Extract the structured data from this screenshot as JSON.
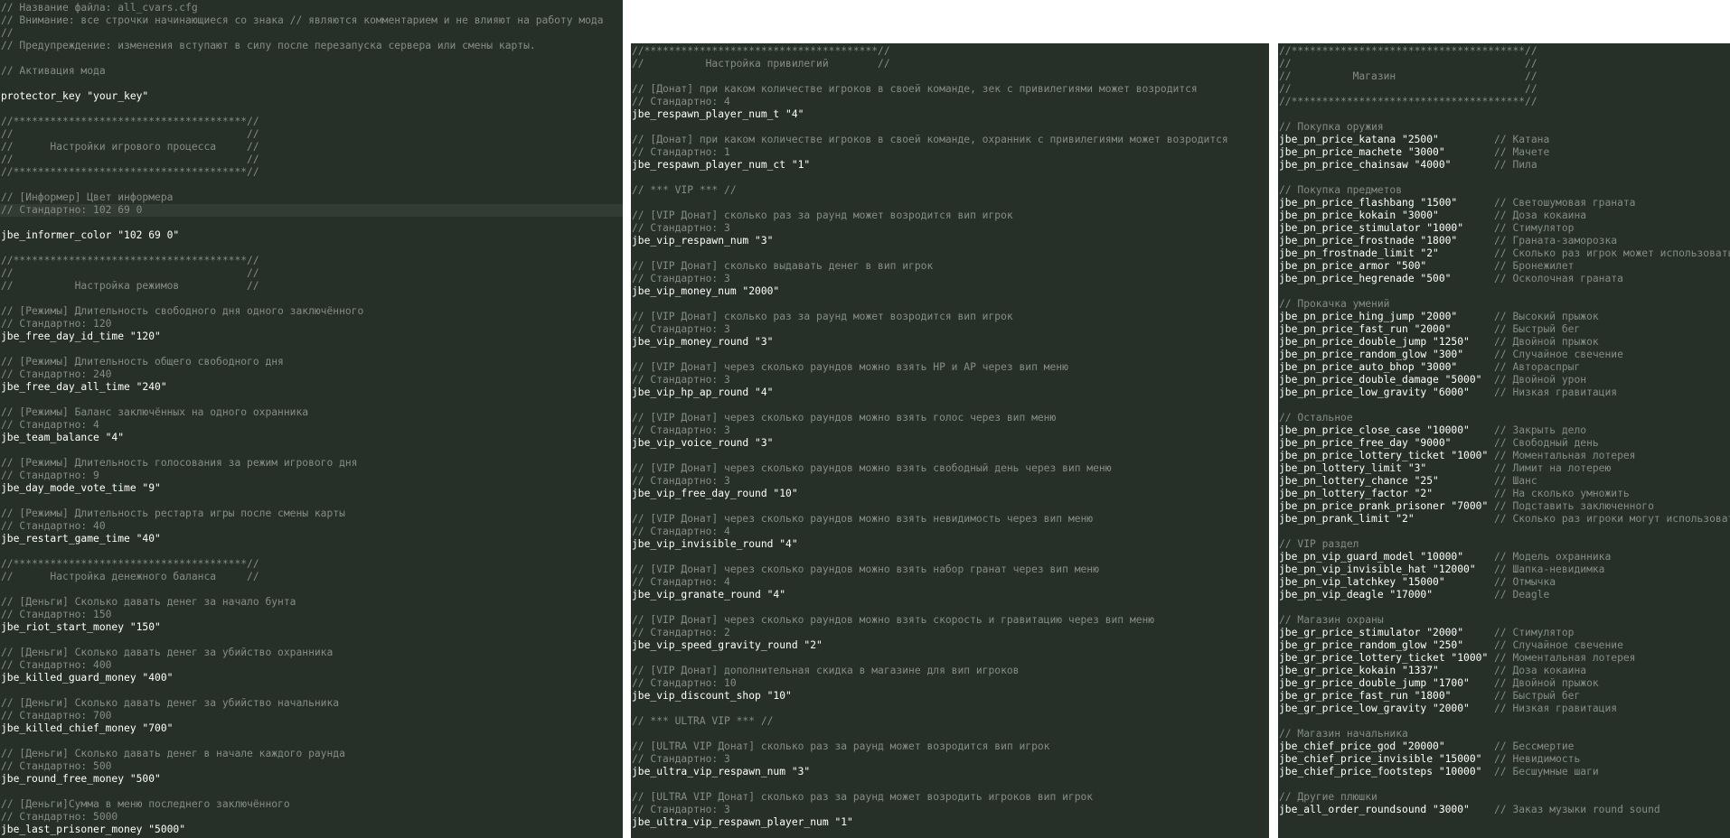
{
  "panels": [
    {
      "lines": [
        {
          "c": "// Название файла: all_cvars.cfg"
        },
        {
          "c": "// Внимание: все строчки начинающиеся со знака // являются комментарием и не влияют на работу мода"
        },
        {
          "c": "//"
        },
        {
          "c": "// Предупреждение: изменения вступают в силу после перезапуска сервера или смены карты."
        },
        {
          "b": true
        },
        {
          "c": "// Активация мода"
        },
        {
          "b": true
        },
        {
          "k": "protector_key \"your_key\""
        },
        {
          "b": true
        },
        {
          "c": "//**************************************//"
        },
        {
          "c": "//                                      //"
        },
        {
          "c": "//      Настройки игрового процесса     //"
        },
        {
          "c": "//                                      //"
        },
        {
          "c": "//**************************************//"
        },
        {
          "b": true
        },
        {
          "c": "// [Информер] Цвет информера"
        },
        {
          "c": "// Стандартно: 102 69 0",
          "hl": true
        },
        {
          "b": true
        },
        {
          "k": "jbe_informer_color \"102 69 0\""
        },
        {
          "b": true
        },
        {
          "c": "//**************************************//"
        },
        {
          "c": "//                                      //"
        },
        {
          "c": "//          Настройка режимов           //"
        },
        {
          "b": true
        },
        {
          "c": "// [Режимы] Длительность свободного дня одного заключённого"
        },
        {
          "c": "// Стандартно: 120"
        },
        {
          "k": "jbe_free_day_id_time \"120\""
        },
        {
          "b": true
        },
        {
          "c": "// [Режимы] Длительность общего свободного дня"
        },
        {
          "c": "// Стандартно: 240"
        },
        {
          "k": "jbe_free_day_all_time \"240\""
        },
        {
          "b": true
        },
        {
          "c": "// [Режимы] Баланс заключённых на одного охранника"
        },
        {
          "c": "// Стандартно: 4"
        },
        {
          "k": "jbe_team_balance \"4\""
        },
        {
          "b": true
        },
        {
          "c": "// [Режимы] Длительность голосования за режим игрового дня"
        },
        {
          "c": "// Стандартно: 9"
        },
        {
          "k": "jbe_day_mode_vote_time \"9\""
        },
        {
          "b": true
        },
        {
          "c": "// [Режимы] Длительность рестарта игры после смены карты"
        },
        {
          "c": "// Стандартно: 40"
        },
        {
          "k": "jbe_restart_game_time \"40\""
        },
        {
          "b": true
        },
        {
          "c": "//**************************************//"
        },
        {
          "c": "//      Настройка денежного баланса     //"
        },
        {
          "b": true
        },
        {
          "c": "// [Деньги] Сколько давать денег за начало бунта"
        },
        {
          "c": "// Стандартно: 150"
        },
        {
          "k": "jbe_riot_start_money \"150\""
        },
        {
          "b": true
        },
        {
          "c": "// [Деньги] Сколько давать денег за убийство охранника"
        },
        {
          "c": "// Стандартно: 400"
        },
        {
          "k": "jbe_killed_guard_money \"400\""
        },
        {
          "b": true
        },
        {
          "c": "// [Деньги] Сколько давать денег за убийство начальника"
        },
        {
          "c": "// Стандартно: 700"
        },
        {
          "k": "jbe_killed_chief_money \"700\""
        },
        {
          "b": true
        },
        {
          "c": "// [Деньги] Сколько давать денег в начале каждого раунда"
        },
        {
          "c": "// Стандартно: 500"
        },
        {
          "k": "jbe_round_free_money \"500\""
        },
        {
          "b": true
        },
        {
          "c": "// [Деньги]Сумма в меню последнего заключённого"
        },
        {
          "c": "// Стандартно: 5000"
        },
        {
          "k": "jbe_last_prisoner_money \"5000\""
        }
      ]
    },
    {
      "lines": [
        {
          "c": "//**************************************//"
        },
        {
          "c": "//          Настройка привилегий        //"
        },
        {
          "b": true
        },
        {
          "c": "// [Донат] при каком количестве игроков в своей команде, зек с привилегиями может возродится"
        },
        {
          "c": "// Стандартно: 4"
        },
        {
          "k": "jbe_respawn_player_num_t \"4\""
        },
        {
          "b": true
        },
        {
          "c": "// [Донат] при каком количестве игроков в своей команде, охранник с привилегиями может возродится"
        },
        {
          "c": "// Стандартно: 1"
        },
        {
          "k": "jbe_respawn_player_num_ct \"1\""
        },
        {
          "b": true
        },
        {
          "c": "// *** VIP *** //"
        },
        {
          "b": true
        },
        {
          "c": "// [VIP Донат] сколько раз за раунд может возродится вип игрок"
        },
        {
          "c": "// Стандартно: 3"
        },
        {
          "k": "jbe_vip_respawn_num \"3\""
        },
        {
          "b": true
        },
        {
          "c": "// [VIP Донат] сколько выдавать денег в вип игрок"
        },
        {
          "c": "// Стандартно: 3"
        },
        {
          "k": "jbe_vip_money_num \"2000\""
        },
        {
          "b": true
        },
        {
          "c": "// [VIP Донат] сколько раз за раунд может возродится вип игрок"
        },
        {
          "c": "// Стандартно: 3"
        },
        {
          "k": "jbe_vip_money_round \"3\""
        },
        {
          "b": true
        },
        {
          "c": "// [VIP Донат] через сколько раундов можно взять HP и AP через вип меню"
        },
        {
          "c": "// Стандартно: 3"
        },
        {
          "k": "jbe_vip_hp_ap_round \"4\""
        },
        {
          "b": true
        },
        {
          "c": "// [VIP Донат] через сколько раундов можно взять голос через вип меню"
        },
        {
          "c": "// Стандартно: 3"
        },
        {
          "k": "jbe_vip_voice_round \"3\""
        },
        {
          "b": true
        },
        {
          "c": "// [VIP Донат] через сколько раундов можно взять свободный день через вип меню"
        },
        {
          "c": "// Стандартно: 3"
        },
        {
          "k": "jbe_vip_free_day_round \"10\""
        },
        {
          "b": true
        },
        {
          "c": "// [VIP Донат] через сколько раундов можно взять невидимость через вип меню"
        },
        {
          "c": "// Стандартно: 4"
        },
        {
          "k": "jbe_vip_invisible_round \"4\""
        },
        {
          "b": true
        },
        {
          "c": "// [VIP Донат] через сколько раундов можно взять набор гранат через вип меню"
        },
        {
          "c": "// Стандартно: 4"
        },
        {
          "k": "jbe_vip_granate_round \"4\""
        },
        {
          "b": true
        },
        {
          "c": "// [VIP Донат] через сколько раундов можно взять скорость и гравитацию через вип меню"
        },
        {
          "c": "// Стандартно: 2"
        },
        {
          "k": "jbe_vip_speed_gravity_round \"2\""
        },
        {
          "b": true
        },
        {
          "c": "// [VIP Донат] дополнительная скидка в магазине для вип игроков"
        },
        {
          "c": "// Стандартно: 10"
        },
        {
          "k": "jbe_vip_discount_shop \"10\""
        },
        {
          "b": true
        },
        {
          "c": "// *** ULTRA VIP *** //"
        },
        {
          "b": true
        },
        {
          "c": "// [ULTRA VIP Донат] сколько раз за раунд может возродится вип игрок"
        },
        {
          "c": "// Стандартно: 3"
        },
        {
          "k": "jbe_ultra_vip_respawn_num \"3\""
        },
        {
          "b": true
        },
        {
          "c": "// [ULTRA VIP Донат] сколько раз за раунд может возродить игроков вип игрок"
        },
        {
          "c": "// Стандартно: 3"
        },
        {
          "k": "jbe_ultra_vip_respawn_player_num \"1\""
        }
      ]
    },
    {
      "lines": [
        {
          "c": "//**************************************//"
        },
        {
          "c": "//                                      //"
        },
        {
          "c": "//          Магазин                     //"
        },
        {
          "c": "//                                      //"
        },
        {
          "c": "//**************************************//"
        },
        {
          "b": true
        },
        {
          "c": "// Покупка оружия"
        },
        {
          "k": "jbe_pn_price_katana \"2500\"         ",
          "t": "// Катана"
        },
        {
          "k": "jbe_pn_price_machete \"3000\"        ",
          "t": "// Мачете"
        },
        {
          "k": "jbe_pn_price_chainsaw \"4000\"       ",
          "t": "// Пила"
        },
        {
          "b": true
        },
        {
          "c": "// Покупка предметов"
        },
        {
          "k": "jbe_pn_price_flashbang \"1500\"      ",
          "t": "// Светошумовая граната"
        },
        {
          "k": "jbe_pn_price_kokain \"3000\"         ",
          "t": "// Доза кокаина"
        },
        {
          "k": "jbe_pn_price_stimulator \"1000\"     ",
          "t": "// Стимулятор"
        },
        {
          "k": "jbe_pn_price_frostnade \"1800\"      ",
          "t": "// Граната-заморозка"
        },
        {
          "k": "jbe_pn_frostnade_limit \"2\"         ",
          "t": "// Сколько раз игрок может использовать"
        },
        {
          "k": "jbe_pn_price_armor \"500\"           ",
          "t": "// Бронежилет"
        },
        {
          "k": "jbe_pn_price_hegrenade \"500\"       ",
          "t": "// Осколочная граната"
        },
        {
          "b": true
        },
        {
          "c": "// Прокачка умений"
        },
        {
          "k": "jbe_pn_price_hing_jump \"2000\"      ",
          "t": "// Высокий прыжок"
        },
        {
          "k": "jbe_pn_price_fast_run \"2000\"       ",
          "t": "// Быстрый бег"
        },
        {
          "k": "jbe_pn_price_double_jump \"1250\"    ",
          "t": "// Двойной прыжок"
        },
        {
          "k": "jbe_pn_price_random_glow \"300\"     ",
          "t": "// Случайное свечение"
        },
        {
          "k": "jbe_pn_price_auto_bhop \"3000\"      ",
          "t": "// Автораспрыг"
        },
        {
          "k": "jbe_pn_price_double_damage \"5000\"  ",
          "t": "// Двойной урон"
        },
        {
          "k": "jbe_pn_price_low_gravity \"6000\"    ",
          "t": "// Низкая гравитация"
        },
        {
          "b": true
        },
        {
          "c": "// Остальное"
        },
        {
          "k": "jbe_pn_price_close_case \"10000\"    ",
          "t": "// Закрыть дело"
        },
        {
          "k": "jbe_pn_price_free_day \"9000\"       ",
          "t": "// Свободный день"
        },
        {
          "k": "jbe_pn_price_lottery_ticket \"1000\" ",
          "t": "// Моментальная лотерея"
        },
        {
          "k": "jbe_pn_lottery_limit \"3\"           ",
          "t": "// Лимит на лотерею"
        },
        {
          "k": "jbe_pn_lottery_chance \"25\"         ",
          "t": "// Шанс"
        },
        {
          "k": "jbe_pn_lottery_factor \"2\"          ",
          "t": "// На сколько умножить"
        },
        {
          "k": "jbe_pn_price_prank_prisoner \"7000\" ",
          "t": "// Подставить заключенного"
        },
        {
          "k": "jbe_pn_prank_limit \"2\"             ",
          "t": "// Сколько раз игроки могут использовать"
        },
        {
          "b": true
        },
        {
          "c": "// VIP раздел"
        },
        {
          "k": "jbe_pn_vip_guard_model \"10000\"     ",
          "t": "// Модель охранника"
        },
        {
          "k": "jbe_pn_vip_invisible_hat \"12000\"   ",
          "t": "// Шапка-невидимка"
        },
        {
          "k": "jbe_pn_vip_latchkey \"15000\"        ",
          "t": "// Отмычка"
        },
        {
          "k": "jbe_pn_vip_deagle \"17000\"          ",
          "t": "// Deagle"
        },
        {
          "b": true
        },
        {
          "c": "// Магазин охраны"
        },
        {
          "k": "jbe_gr_price_stimulator \"2000\"     ",
          "t": "// Стимулятор"
        },
        {
          "k": "jbe_gr_price_random_glow \"250\"     ",
          "t": "// Случайное свечение"
        },
        {
          "k": "jbe_gr_price_lottery_ticket \"1000\" ",
          "t": "// Моментальная лотерея"
        },
        {
          "k": "jbe_gr_price_kokain \"1337\"         ",
          "t": "// Доза кокаина"
        },
        {
          "k": "jbe_gr_price_double_jump \"1700\"    ",
          "t": "// Двойной прыжок"
        },
        {
          "k": "jbe_gr_price_fast_run \"1800\"       ",
          "t": "// Быстрый бег"
        },
        {
          "k": "jbe_gr_price_low_gravity \"2000\"    ",
          "t": "// Низкая гравитация"
        },
        {
          "b": true
        },
        {
          "c": "// Магазин начальника"
        },
        {
          "k": "jbe_chief_price_god \"20000\"        ",
          "t": "// Бессмертие"
        },
        {
          "k": "jbe_chief_price_invisible \"15000\"  ",
          "t": "// Невидимость"
        },
        {
          "k": "jbe_chief_price_footsteps \"10000\"  ",
          "t": "// Бесшумные шаги"
        },
        {
          "b": true
        },
        {
          "c": "// Другие плюшки"
        },
        {
          "k": "jbe_all_order_roundsound \"3000\"    ",
          "t": "// Заказ музыки round sound"
        }
      ]
    }
  ]
}
